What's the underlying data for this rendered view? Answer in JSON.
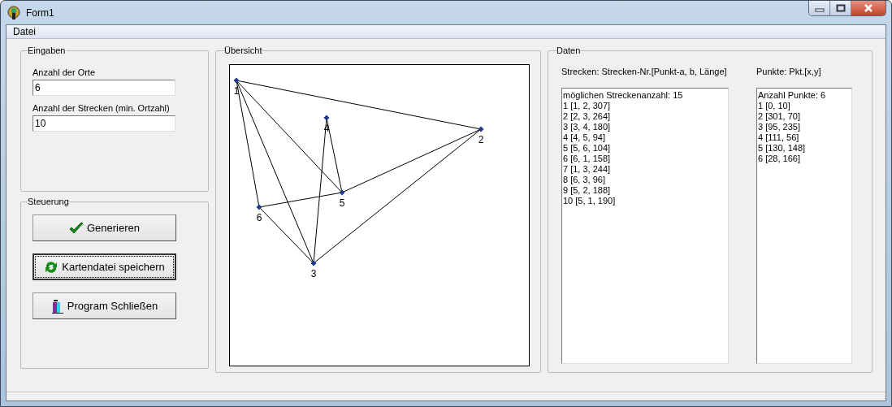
{
  "window": {
    "title": "Form1"
  },
  "menu": [
    "Datei"
  ],
  "eingaben": {
    "title": "Eingaben",
    "fields": [
      {
        "label": "Anzahl der Orte",
        "value": "6"
      },
      {
        "label": "Anzahl der Strecken (min. Ortzahl)",
        "value": "10"
      }
    ]
  },
  "steuerung": {
    "title": "Steuerung",
    "buttons": [
      {
        "label": "Generieren",
        "kind": "check",
        "focused": false
      },
      {
        "label": "Kartendatei speichern",
        "kind": "refresh",
        "focused": true
      },
      {
        "label": "Program Schließen",
        "kind": "exit",
        "focused": false
      }
    ]
  },
  "uebersicht": {
    "title": "Übersicht",
    "nodes": [
      {
        "label": "1"
      },
      {
        "label": "2"
      },
      {
        "label": "3"
      },
      {
        "label": "4"
      },
      {
        "label": "5"
      },
      {
        "label": "6"
      }
    ]
  },
  "daten": {
    "title": "Daten",
    "lists": [
      {
        "heading": "Strecken: Strecken-Nr.[Punkt-a, b, Länge]",
        "lines": [
          "möglichen Streckenanzahl: 15",
          "1 [1, 2, 307]",
          "2 [2, 3, 264]",
          "3 [3, 4, 180]",
          "4 [4, 5, 94]",
          "5 [5, 6, 104]",
          "6 [6, 1, 158]",
          "7 [1, 3, 244]",
          "8 [6, 3, 96]",
          "9 [5, 2, 188]",
          "10 [5, 1, 190]"
        ]
      },
      {
        "heading": "Punkte: Pkt.[x,y]",
        "lines": [
          "Anzahl Punkte: 6",
          "1 [0, 10]",
          "2 [301, 70]",
          "3 [95, 235]",
          "4 [111, 56]",
          "5 [130, 148]",
          "6 [28, 166]"
        ]
      }
    ]
  }
}
